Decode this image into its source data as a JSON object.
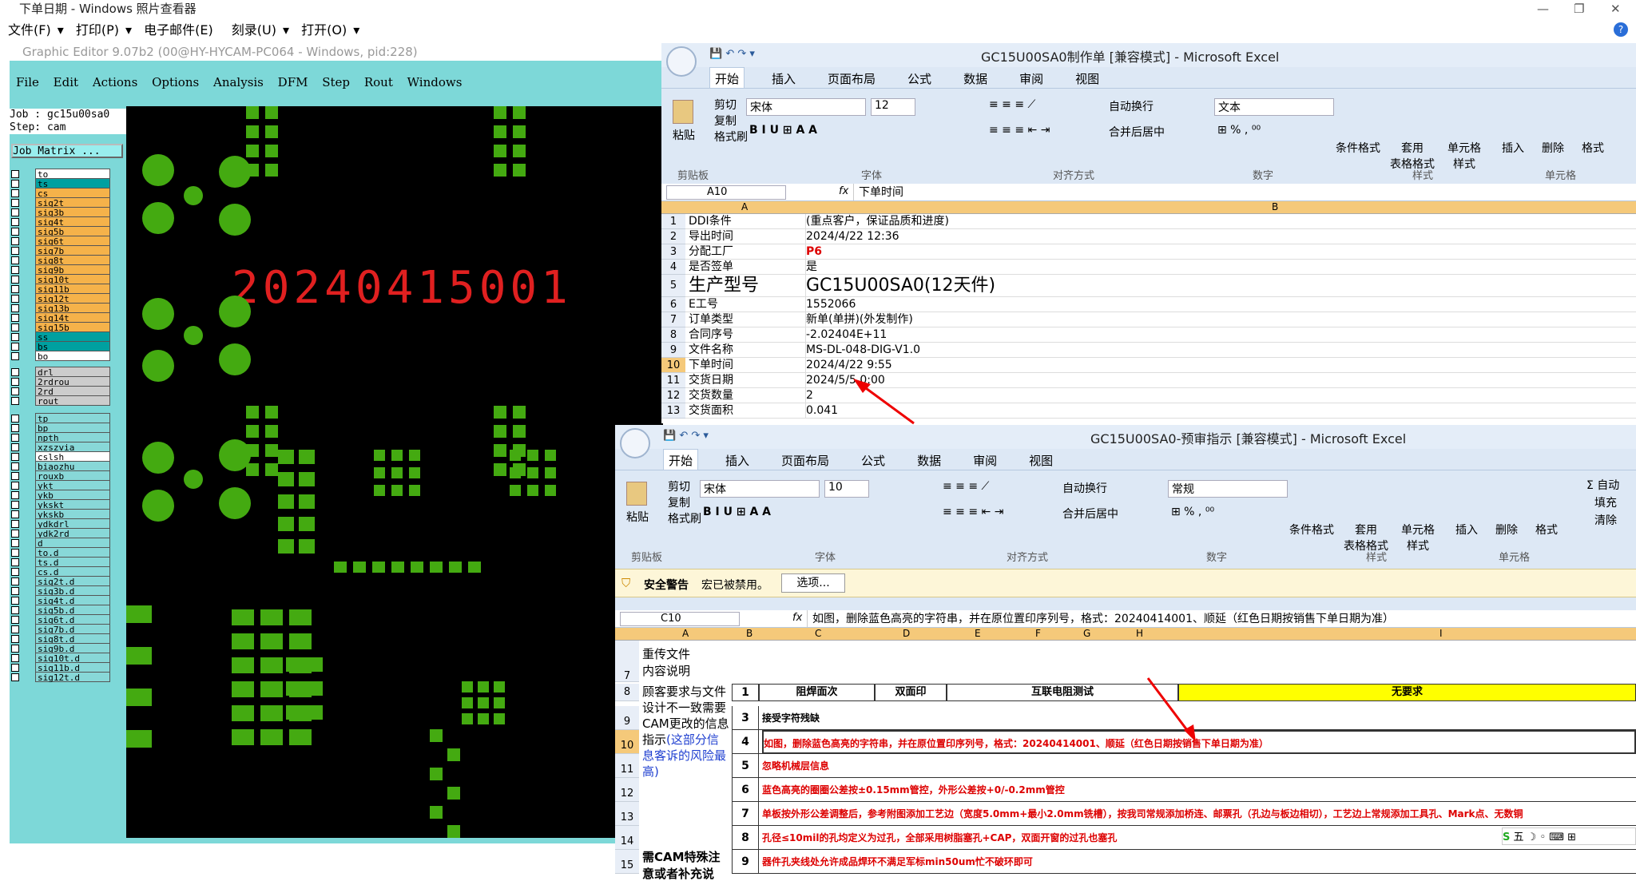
{
  "viewer": {
    "title": "下单日期 - Windows 照片查看器",
    "menu": [
      "文件(F)",
      "打印(P)",
      "电子邮件(E)",
      "刻录(U)",
      "打开(O)"
    ]
  },
  "ge": {
    "title": "Graphic Editor 9.07b2 (00@HY-HYCAM-PC064 - Windows, pid:228)",
    "menu": [
      "File",
      "Edit",
      "Actions",
      "Options",
      "Analysis",
      "DFM",
      "Step",
      "Rout",
      "Windows"
    ],
    "job": "Job : gc15u00sa0",
    "step": "Step: cam",
    "matrix_btn": "Job Matrix ...",
    "canvas_text": "20240415001",
    "layers": [
      "to",
      "ts",
      "cs",
      "sig2t",
      "sig3b",
      "sig4t",
      "sig5b",
      "sig6t",
      "sig7b",
      "sig8t",
      "sig9b",
      "sig10t",
      "sig11b",
      "sig12t",
      "sig13b",
      "sig14t",
      "sig15b",
      "ss",
      "bs",
      "bo",
      "drl",
      "2rdrou",
      "2rd",
      "rout",
      "tp",
      "bp",
      "npth",
      "xzszvia",
      "cslsh",
      "biaozhu",
      "rouxb",
      "ykt",
      "ykb",
      "ykskt",
      "ykskb",
      "ydkdrl",
      "ydk2rd",
      "d",
      "to.d",
      "ts.d",
      "cs.d",
      "sig2t.d",
      "sig3b.d",
      "sig4t.d",
      "sig5b.d",
      "sig6t.d",
      "sig7b.d",
      "sig8t.d",
      "sig9b.d",
      "sig10t.d",
      "sig11b.d",
      "sig12t.d"
    ]
  },
  "excel1": {
    "title": "GC15U00SA0制作单 [兼容模式] - Microsoft Excel",
    "tabs": [
      "开始",
      "插入",
      "页面布局",
      "公式",
      "数据",
      "审阅",
      "视图"
    ],
    "font": "宋体",
    "size": "12",
    "numfmt": "文本",
    "ribbon": {
      "paste": "粘贴",
      "cut": "剪切",
      "copy": "复制",
      "painter": "格式刷",
      "clipboard": "剪贴板",
      "font_grp": "字体",
      "align_grp": "对齐方式",
      "number_grp": "数字",
      "style_grp": "样式",
      "cells_grp": "单元格",
      "wrap": "自动换行",
      "merge": "合并后居中",
      "cond": "条件格式",
      "table": "套用\n表格格式",
      "cellstyle": "单元格\n样式",
      "insert": "插入",
      "delete": "删除",
      "format": "格式"
    },
    "namebox": "A10",
    "formula": "下单时间",
    "cols": [
      "A",
      "B"
    ],
    "rows": [
      {
        "n": "1",
        "a": "DDI条件",
        "b": "(重点客户，保证品质和进度)"
      },
      {
        "n": "2",
        "a": "导出时间",
        "b": "2024/4/22 12:36"
      },
      {
        "n": "3",
        "a": "分配工厂",
        "b": "P6"
      },
      {
        "n": "4",
        "a": "是否签单",
        "b": "是"
      },
      {
        "n": "5",
        "a": "生产型号",
        "b": "GC15U00SA0(12天件)"
      },
      {
        "n": "6",
        "a": "E工号",
        "b": "1552066"
      },
      {
        "n": "7",
        "a": "订单类型",
        "b": "新单(单拼)(外发制作)"
      },
      {
        "n": "8",
        "a": "合同序号",
        "b": "-2.02404E+11"
      },
      {
        "n": "9",
        "a": "文件名称",
        "b": "MS-DL-048-DIG-V1.0"
      },
      {
        "n": "10",
        "a": "下单时间",
        "b": "2024/4/22 9:55"
      },
      {
        "n": "11",
        "a": "交货日期",
        "b": "2024/5/5 0:00"
      },
      {
        "n": "12",
        "a": "交货数量",
        "b": "2"
      },
      {
        "n": "13",
        "a": "交货面积",
        "b": "0.041"
      }
    ]
  },
  "excel2": {
    "title": "GC15U00SA0-预审指示 [兼容模式] - Microsoft Excel",
    "tabs": [
      "开始",
      "插入",
      "页面布局",
      "公式",
      "数据",
      "审阅",
      "视图"
    ],
    "font": "宋体",
    "size": "10",
    "numfmt": "常规",
    "ribbon": {
      "paste": "粘贴",
      "cut": "剪切",
      "copy": "复制",
      "painter": "格式刷",
      "clipboard": "剪贴板",
      "font_grp": "字体",
      "align_grp": "对齐方式",
      "number_grp": "数字",
      "style_grp": "样式",
      "cells_grp": "单元格",
      "wrap": "自动换行",
      "merge": "合并后居中",
      "cond": "条件格式",
      "table": "套用\n表格格式",
      "cellstyle": "单元格\n样式",
      "insert": "插入",
      "delete": "删除",
      "format": "格式",
      "autosum": "Σ 自动",
      "fill": "填充",
      "clear": "清除"
    },
    "security": {
      "label": "安全警告",
      "msg": "宏已被禁用。",
      "btn": "选项..."
    },
    "namebox": "C10",
    "formula": "如图，删除蓝色高亮的字符串，并在原位置印序列号，格式：20240414001、顺延（红色日期按销售下单日期为准）",
    "cols": [
      "A",
      "B",
      "C",
      "D",
      "E",
      "F",
      "G",
      "H",
      "I"
    ],
    "r7a": "重传文件\n内容说明",
    "r8a": "顾客要求与文件设计不一致需要CAM更改的信息指示",
    "r8a_blue": "(这部分信息客诉的风险最高)",
    "r14a": "需CAM特殊注意或者补充说",
    "row8": {
      "no": "1",
      "c1": "阻焊面次",
      "c2": "双面印",
      "c3": "互联电阻测试",
      "c4": "无要求"
    },
    "items": [
      {
        "n": "9",
        "no": "3",
        "t": "接受字符残缺",
        "red": false
      },
      {
        "n": "10",
        "no": "4",
        "t": "如图，删除蓝色高亮的字符串，并在原位置印序列号，格式：20240414001、顺延（红色日期按销售下单日期为准）",
        "red": true
      },
      {
        "n": "11",
        "no": "5",
        "t": "忽略机械层信息",
        "red": true
      },
      {
        "n": "12",
        "no": "6",
        "t": "蓝色高亮的圈圈公差按±0.15mm管控，外形公差按+0/-0.2mm管控",
        "red": true
      },
      {
        "n": "13",
        "no": "7",
        "t": "单板按外形公差调整后，参考附图添加工艺边（宽度5.0mm+最小2.0mm铣槽），按我司常规添加桥连、邮票孔（孔边与板边相切），工艺边上常规添加工具孔、Mark点、无数铜",
        "red": true
      },
      {
        "n": "14",
        "no": "8",
        "t": "孔径≤10mil的孔均定义为过孔，全部采用树脂塞孔+CAP，双面开窗的过孔也塞孔",
        "red": true
      },
      {
        "n": "15",
        "no": "9",
        "t": "器件孔夹线处允许成品焊环不满足军标min50um忙不破环即可",
        "red": true
      }
    ]
  }
}
